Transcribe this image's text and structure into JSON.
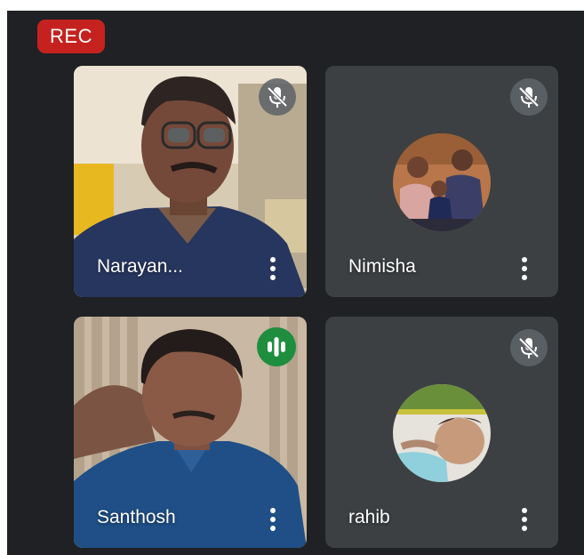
{
  "recording": {
    "label": "REC",
    "color": "#c5221f"
  },
  "participants": [
    {
      "name": "Narayan...",
      "muted": true,
      "video": "camera",
      "speaking": false
    },
    {
      "name": "Nimisha",
      "muted": true,
      "video": "avatar",
      "speaking": false
    },
    {
      "name": "Santhosh",
      "muted": false,
      "video": "camera",
      "speaking": true
    },
    {
      "name": "rahib",
      "muted": true,
      "video": "avatar",
      "speaking": false
    }
  ],
  "icons": {
    "mute": "mic-off-icon",
    "speaking": "audio-level-icon",
    "more": "more-vert-icon"
  },
  "colors": {
    "stage_background": "#1f2124",
    "tile_background": "#3c4043",
    "speaking_indicator": "#1e8e3e"
  }
}
